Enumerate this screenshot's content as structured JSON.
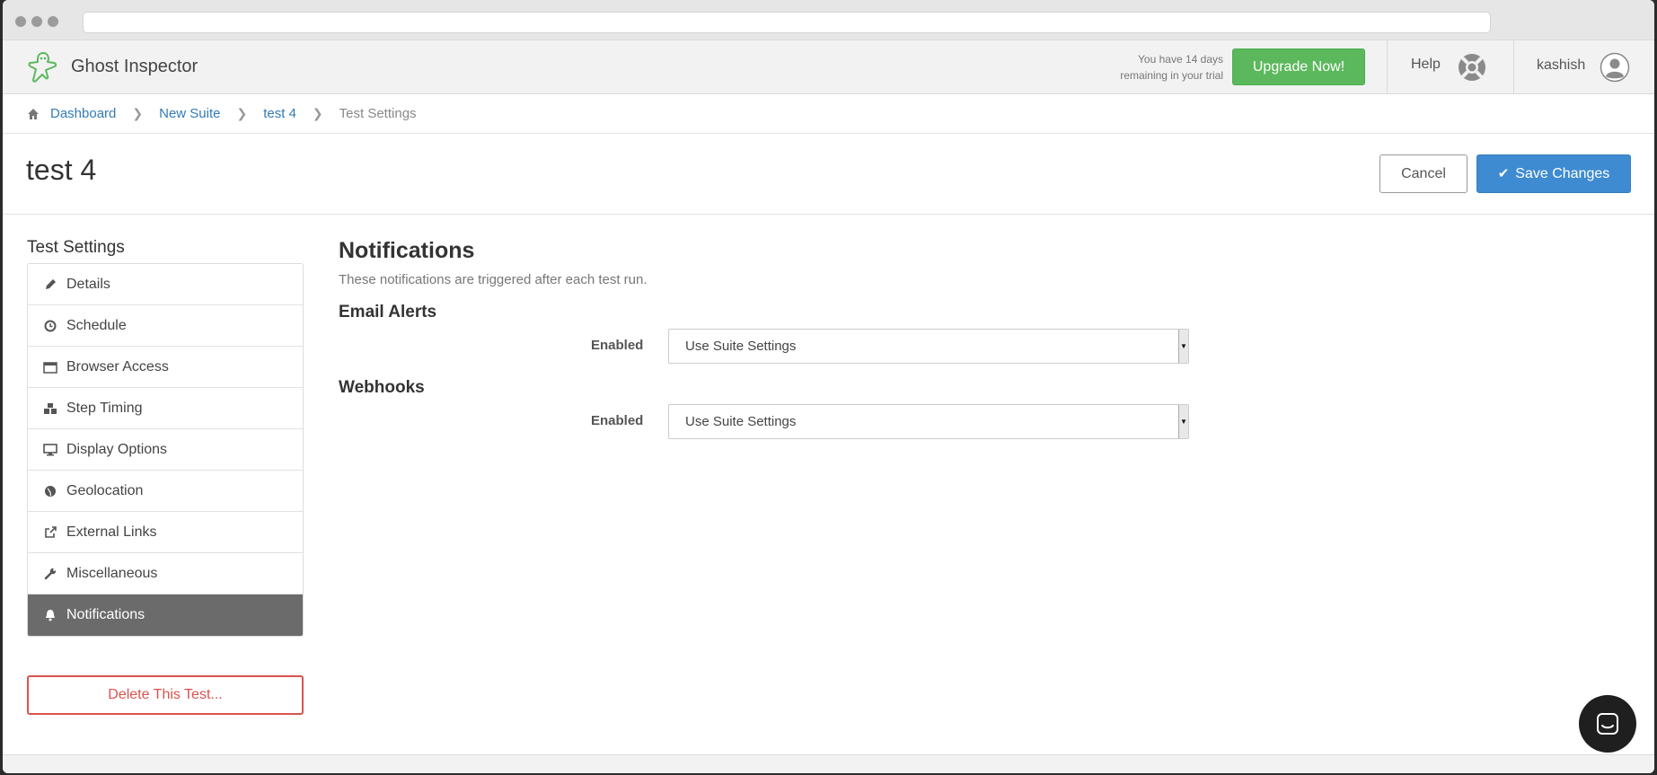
{
  "header": {
    "brand": "Ghost Inspector",
    "trial_line1": "You have 14 days",
    "trial_line2": "remaining in your trial",
    "upgrade_label": "Upgrade Now!",
    "help_label": "Help",
    "user_name": "kashish"
  },
  "breadcrumb": {
    "items": [
      "Dashboard",
      "New Suite",
      "test 4"
    ],
    "current": "Test Settings"
  },
  "page": {
    "title": "test 4",
    "cancel_label": "Cancel",
    "save_label": "Save Changes"
  },
  "sidebar": {
    "title": "Test Settings",
    "items": [
      {
        "label": "Details",
        "icon": "pencil-icon"
      },
      {
        "label": "Schedule",
        "icon": "clock-icon"
      },
      {
        "label": "Browser Access",
        "icon": "browser-window-icon"
      },
      {
        "label": "Step Timing",
        "icon": "cubes-icon"
      },
      {
        "label": "Display Options",
        "icon": "monitor-icon"
      },
      {
        "label": "Geolocation",
        "icon": "globe-icon"
      },
      {
        "label": "External Links",
        "icon": "external-link-icon"
      },
      {
        "label": "Miscellaneous",
        "icon": "wrench-icon"
      },
      {
        "label": "Notifications",
        "icon": "bell-icon",
        "active": true
      }
    ],
    "delete_label": "Delete This Test..."
  },
  "main": {
    "heading": "Notifications",
    "subtitle": "These notifications are triggered after each test run.",
    "sections": [
      {
        "title": "Email Alerts",
        "field_label": "Enabled",
        "value": "Use Suite Settings"
      },
      {
        "title": "Webhooks",
        "field_label": "Enabled",
        "value": "Use Suite Settings"
      }
    ]
  },
  "colors": {
    "upgrade": "#5cb85c",
    "primary": "#3f8bd1",
    "danger": "#d9534f",
    "active_nav": "#6b6b6b",
    "link": "#337ab7"
  }
}
